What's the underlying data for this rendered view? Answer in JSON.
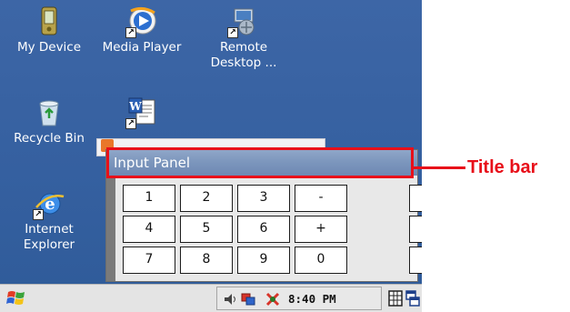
{
  "desktop": {
    "icons": [
      {
        "name": "my-device-icon",
        "label": "My Device"
      },
      {
        "name": "media-player-icon",
        "label": "Media Player"
      },
      {
        "name": "remote-desktop-icon",
        "label": "Remote\nDesktop ..."
      },
      {
        "name": "recycle-bin-icon",
        "label": "Recycle Bin"
      },
      {
        "name": "word-document-icon",
        "label": ""
      },
      {
        "name": "internet-explorer-icon",
        "label": "Internet\nExplorer"
      }
    ],
    "background_color": "#3560a0"
  },
  "input_panel": {
    "title": "Input Panel",
    "keys": [
      "1",
      "2",
      "3",
      "-",
      "*",
      "4",
      "5",
      "6",
      "+",
      "/",
      "7",
      "8",
      "9",
      "0",
      "="
    ]
  },
  "taskbar": {
    "start_icon": "windows-flag-icon",
    "tray_icons": [
      "volume-icon",
      "network-icon"
    ],
    "clock": "8:40 PM",
    "keyboard_icon": "keyboard-icon",
    "switch_icon": "switch-window-icon"
  },
  "annotation": {
    "label": "Title bar",
    "color": "#e8101a"
  }
}
